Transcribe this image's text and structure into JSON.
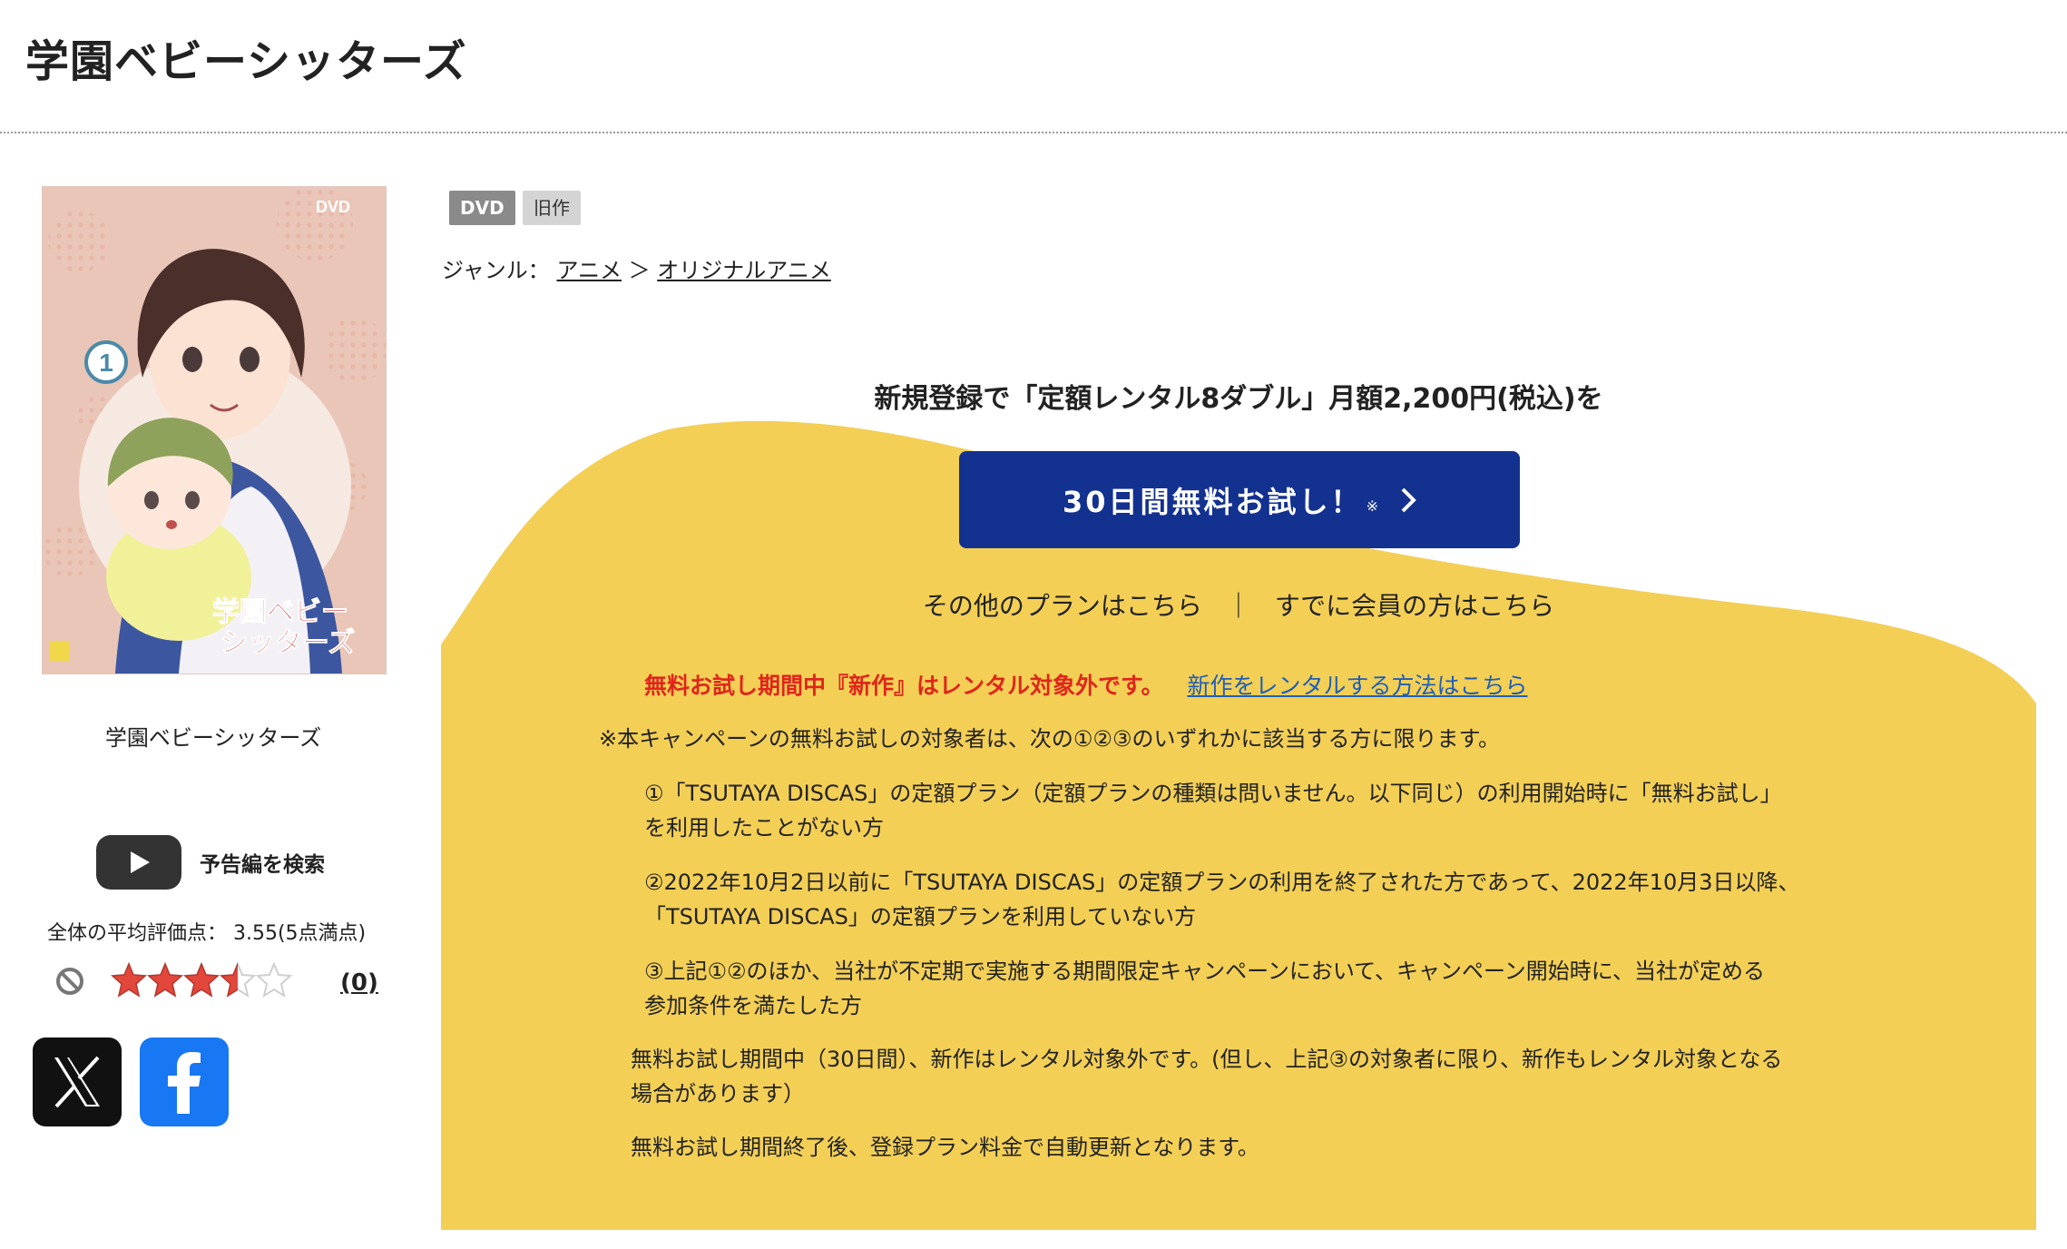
{
  "page": {
    "title": "学園ベビーシッターズ"
  },
  "product": {
    "cover_title": "学園ベビーシッターズ",
    "cover_logo_line1": "学園ベビー",
    "cover_logo_line2": "シッターズ",
    "cover_volume": "1",
    "cover_disc_label": "DVD",
    "caption": "学園ベビーシッターズ",
    "trailer_label": "予告編を検索",
    "avg_rating_text": "全体の平均評価点： 3.55(5点満点)",
    "rating_value": 3.55,
    "rating_max": 5,
    "review_count_open": "(",
    "review_count": "0",
    "review_count_close": ")",
    "badges": [
      "DVD",
      "旧作"
    ],
    "genre": {
      "label": "ジャンル：",
      "sep": "＞",
      "items": [
        "アニメ",
        "オリジナルアニメ"
      ]
    }
  },
  "social": {
    "x_icon": "x-logo-icon",
    "fb_icon": "facebook-logo-icon"
  },
  "promo": {
    "headline": "新規登録で「定額レンタル8ダブル」月額2,200円(税込)を",
    "cta_label": "30日間無料お試し！",
    "cta_note": "※",
    "other_plans": "その他のプランはこちら",
    "separator": "｜",
    "member_link": "すでに会員の方はこちら",
    "notice_red": "無料お試し期間中『新作』はレンタル対象外です。",
    "notice_link": "新作をレンタルする方法はこちら",
    "conditions_intro": "※本キャンペーンの無料お試しの対象者は、次の①②③のいずれかに該当する方に限ります。",
    "conditions": [
      [
        "①「TSUTAYA DISCAS」の定額プラン（定額プランの種類は問いません。以下同じ）の利用開始時に「無料お試し」",
        "を利用したことがない方"
      ],
      [
        "②2022年10月2日以前に「TSUTAYA DISCAS」の定額プランの利用を終了された方であって、2022年10月3日以降、",
        "「TSUTAYA DISCAS」の定額プランを利用していない方"
      ],
      [
        "③上記①②のほか、当社が不定期で実施する期間限定キャンペーンにおいて、キャンペーン開始時に、当社が定める",
        "参加条件を満たした方"
      ]
    ],
    "note1": [
      "無料お試し期間中（30日間）、新作はレンタル対象外です。(但し、上記③の対象者に限り、新作もレンタル対象となる",
      "場合があります）"
    ],
    "note2": "無料お試し期間終了後、登録プラン料金で自動更新となります。"
  },
  "colors": {
    "accent_yellow": "#f3cf56",
    "cta_blue": "#13318f",
    "notice_red": "#e0261b",
    "link_blue": "#1e5fb8",
    "star_red": "#e2473b"
  }
}
